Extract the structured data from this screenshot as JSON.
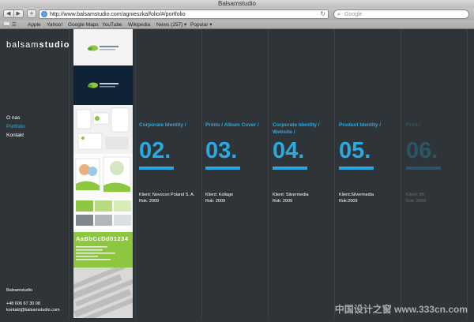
{
  "browser": {
    "window_title": "Balsamstudio",
    "url": "http://www.balsamstudio.com/agnieszka/folio/#/portfolio",
    "search_placeholder": "Google",
    "bookmarks": [
      "Apple",
      "Yahoo!",
      "Google Maps",
      "YouTube",
      "Wikipedia",
      "News (257) ▾",
      "Popular ▾"
    ]
  },
  "site": {
    "logo_light": "balsam",
    "logo_bold": "studio",
    "menu": [
      "O nas",
      "Portfolio",
      "Kontakt"
    ],
    "active_menu": "Portfolio",
    "footer_name": "Balsamstudio",
    "footer_phone": "+48 606 67 30 08",
    "footer_email": "kontakt@balsamstudio.com"
  },
  "projects": [
    {
      "title": "Corporate Identity /",
      "number": "02.",
      "client": "Klient: Novocon Poland S. A.",
      "year": "Rok: 2009"
    },
    {
      "title": "Prints /  Album Cover /",
      "number": "03.",
      "client": "Klient: Kollage",
      "year": "Rok: 2009"
    },
    {
      "title": "Corporate Identity / Website /",
      "number": "04.",
      "client": "Klient: Silvermedia",
      "year": "Rok: 2009"
    },
    {
      "title": "Product Identity /",
      "number": "05.",
      "client": "Klient:Silvermedia",
      "year": "Rok:2009"
    },
    {
      "title": "Print /",
      "number": "06.",
      "client": "Klient: BF",
      "year": "Rok: 2009"
    }
  ],
  "thumb_texts": {
    "letters": "AaBbCcDd01234"
  },
  "watermark": "中国设计之窗 www.333cn.com",
  "colors": {
    "accent": "#29aae1",
    "background": "#2f3439"
  }
}
